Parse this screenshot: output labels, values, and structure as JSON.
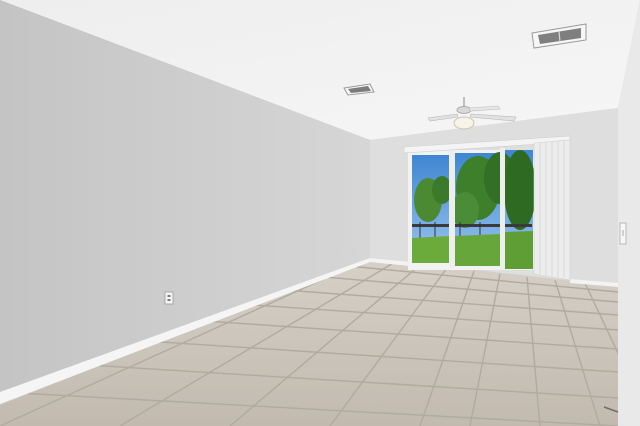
{
  "scene": {
    "kind": "empty-room-interior",
    "features": [
      "textured-ceiling",
      "ceiling-fan",
      "hvac-vent",
      "sliding-glass-door",
      "vertical-blinds",
      "tile-floor",
      "baseboards",
      "electrical-outlet",
      "light-switch"
    ],
    "view_through_door": "green-lawn-with-trees-and-fence",
    "colors": {
      "ceiling": "#f1f1f1",
      "left_wall": "#cdcdcd",
      "back_wall": "#dedede",
      "right_wall": "#e8e8e8",
      "floor_tile": "#c9c2b8",
      "grout": "#b4ada3",
      "baseboard": "#f6f6f6",
      "sky": "#4a8fd6",
      "foliage": "#3f7e2c",
      "lawn": "#67a83a"
    }
  }
}
